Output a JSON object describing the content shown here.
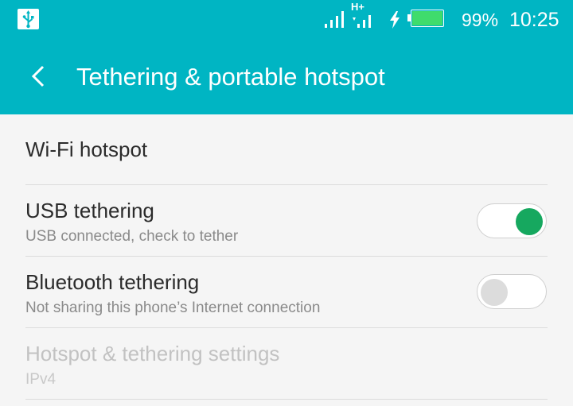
{
  "status_bar": {
    "usb_icon": "usb-icon",
    "network_type": "H+",
    "battery_percent_text": "99%",
    "battery_level": 0.99,
    "time": "10:25",
    "colors": {
      "bar_bg": "#00b5c3",
      "battery_fill": "#3fdc6c"
    }
  },
  "toolbar": {
    "back_icon": "chevron-left-icon",
    "title": "Tethering & portable hotspot"
  },
  "items": [
    {
      "title": "Wi-Fi hotspot"
    },
    {
      "title": "USB tethering",
      "subtitle": "USB connected, check to tether",
      "toggle": "on"
    },
    {
      "title": "Bluetooth tethering",
      "subtitle": "Not sharing this phone’s Internet connection",
      "toggle": "off"
    },
    {
      "title": "Hotspot & tethering settings",
      "subtitle": "IPv4",
      "disabled": true
    }
  ],
  "colors": {
    "accent": "#00b5c3",
    "toggle_on": "#16a85f",
    "toggle_off": "#dcdcdc",
    "background": "#f5f5f5"
  }
}
